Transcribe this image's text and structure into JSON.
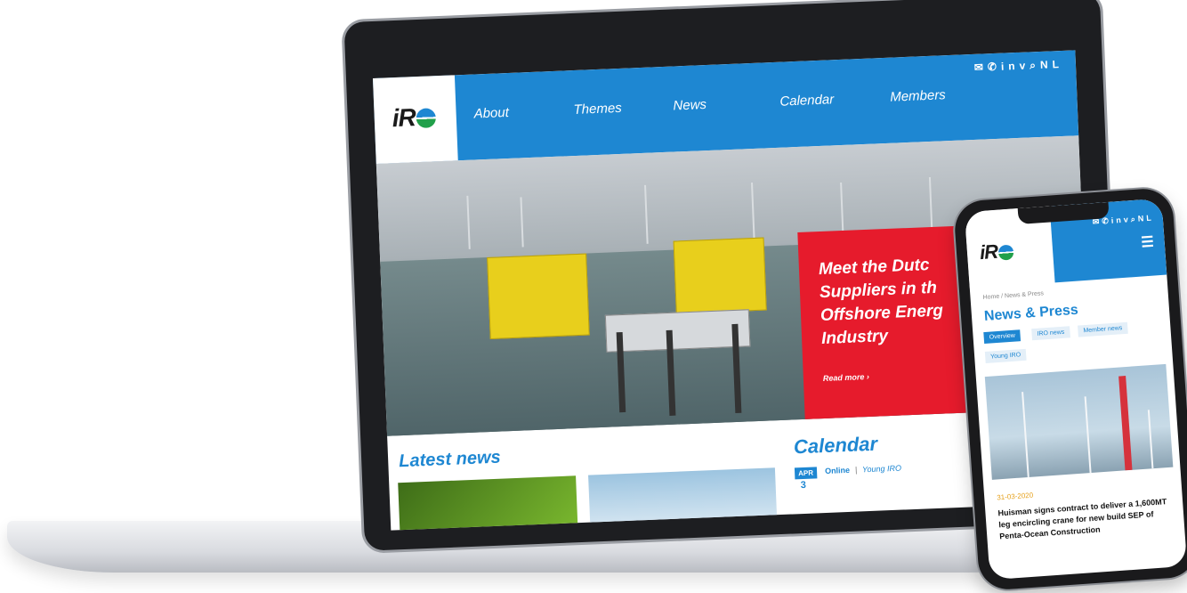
{
  "laptop": {
    "logo": "iR",
    "nav": [
      "About",
      "Themes",
      "News",
      "Calendar",
      "Members"
    ],
    "utility_icons": [
      "mail-icon",
      "phone-icon",
      "linkedin-icon",
      "vimeo-icon",
      "search-icon"
    ],
    "utility_lang": "NL",
    "hero": {
      "title": "Meet the Dutc\nSuppliers in th\nOffshore Energ\nIndustry",
      "read_more": "Read more ›"
    },
    "latest_news": "Latest news",
    "calendar": {
      "title": "Calendar",
      "month": "APR",
      "day": "3",
      "type": "Online",
      "separator": "|",
      "category": "Young IRO"
    }
  },
  "phone": {
    "logo": "iR",
    "utility_lang": "NL",
    "menu_icon": "hamburger-icon",
    "breadcrumb": "Home / News & Press",
    "title": "News & Press",
    "tabs": [
      "Overview",
      "IRO news",
      "Member news",
      "Young IRO"
    ],
    "active_tab": "Overview",
    "article": {
      "date": "31-03-2020",
      "headline": "Huisman signs contract to deliver a 1,600MT leg encircling crane for new build SEP of Penta-Ocean Construction"
    }
  },
  "colors": {
    "brand_blue": "#1e87d2",
    "hero_red": "#e61b2c",
    "date_orange": "#e6a11c"
  }
}
